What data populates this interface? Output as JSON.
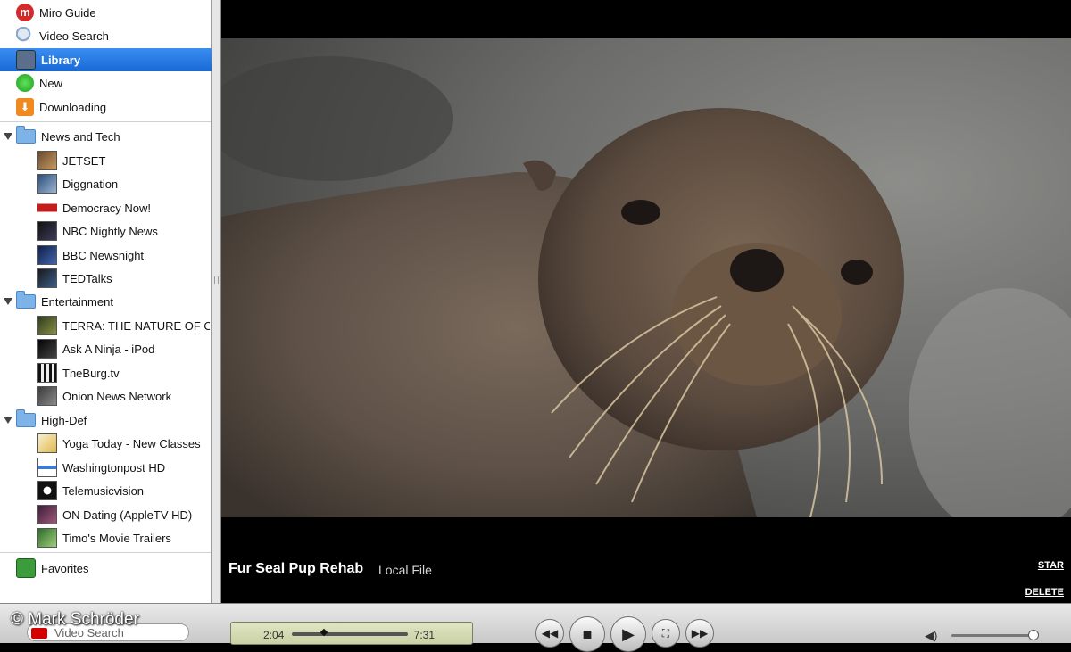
{
  "sidebar": {
    "top_items": [
      {
        "label": "Miro Guide",
        "icon": "miro-logo-icon",
        "color": "#d62929"
      },
      {
        "label": "Video Search",
        "icon": "magnifier-icon",
        "color": "#9fb7d6"
      },
      {
        "label": "Library",
        "icon": "library-icon",
        "color": "#5b6f8c",
        "selected": true
      },
      {
        "label": "New",
        "icon": "green-dot-icon",
        "color": "#26b021"
      },
      {
        "label": "Downloading",
        "icon": "download-arrow-icon",
        "color": "#f08a1e"
      }
    ],
    "folders": [
      {
        "label": "News and Tech",
        "channels": [
          "JETSET",
          "Diggnation",
          "Democracy Now!",
          "NBC Nightly News",
          "BBC Newsnight",
          "TEDTalks"
        ]
      },
      {
        "label": "Entertainment",
        "channels": [
          "TERRA: THE NATURE OF O",
          "Ask A Ninja - iPod",
          "TheBurg.tv",
          "Onion News Network"
        ]
      },
      {
        "label": "High-Def",
        "channels": [
          "Yoga Today - New Classes",
          "Washingtonpost HD",
          "Telemusicvision",
          "ON Dating (AppleTV HD)",
          "Timo's Movie Trailers"
        ]
      }
    ],
    "favorites": {
      "label": "Favorites",
      "icon": "favorites-icon"
    }
  },
  "video": {
    "title": "Fur Seal Pup Rehab",
    "source": "Local File",
    "star_label": "STAR",
    "delete_label": "DELETE"
  },
  "bottombar": {
    "search_placeholder": "Video Search",
    "watermark": "© Mark Schröder",
    "elapsed": "2:04",
    "total": "7:31",
    "progress_fraction": 0.28,
    "volume_fraction": 0.95,
    "buttons": [
      {
        "name": "rewind-button",
        "glyph": "◀◀"
      },
      {
        "name": "stop-button",
        "glyph": "■"
      },
      {
        "name": "play-button",
        "glyph": "▶"
      },
      {
        "name": "fullscreen-button",
        "glyph": "⛶"
      },
      {
        "name": "fast-forward-button",
        "glyph": "▶▶"
      }
    ],
    "volume_icon": "◀)"
  }
}
